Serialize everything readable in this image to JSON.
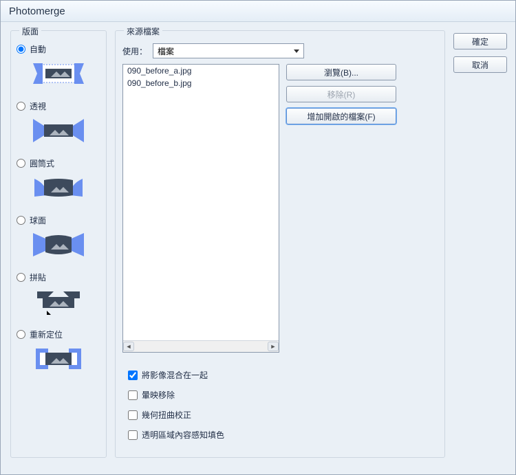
{
  "window": {
    "title": "Photomerge"
  },
  "layout_group": {
    "title": "版面",
    "options": [
      {
        "label": "自動",
        "value": "auto",
        "selected": true
      },
      {
        "label": "透視",
        "value": "perspective",
        "selected": false
      },
      {
        "label": "圓筒式",
        "value": "cylindrical",
        "selected": false
      },
      {
        "label": "球面",
        "value": "spherical",
        "selected": false
      },
      {
        "label": "拼貼",
        "value": "collage",
        "selected": false
      },
      {
        "label": "重新定位",
        "value": "reposition",
        "selected": false
      }
    ]
  },
  "source_group": {
    "title": "來源檔案",
    "use_label": "使用：",
    "use_dropdown": {
      "selected": "檔案"
    },
    "files": [
      "090_before_a.jpg",
      "090_before_b.jpg"
    ],
    "browse_label": "瀏覽(B)...",
    "remove_label": "移除(R)",
    "add_open_label": "增加開啟的檔案(F)"
  },
  "options": {
    "blend": {
      "label": "將影像混合在一起",
      "checked": true
    },
    "vignette": {
      "label": "暈映移除",
      "checked": false
    },
    "geom": {
      "label": "幾何扭曲校正",
      "checked": false
    },
    "fill": {
      "label": "透明區域內容感知填色",
      "checked": false
    }
  },
  "actions": {
    "ok": "確定",
    "cancel": "取消"
  }
}
